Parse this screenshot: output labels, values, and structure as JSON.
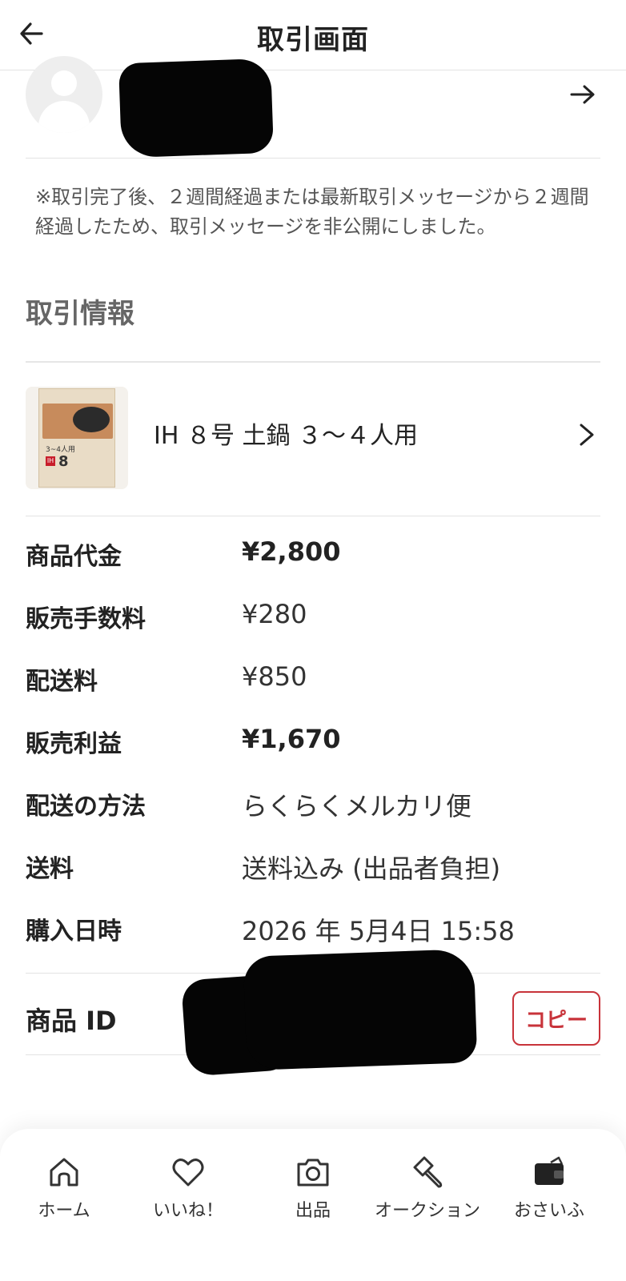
{
  "header": {
    "title": "取引画面"
  },
  "notice": "※取引完了後、２週間経過または最新取引メッセージから２週間経過したため、取引メッセージを非公開にしました。",
  "section_title": "取引情報",
  "product": {
    "name": "IH ８号 土鍋 ３～４人用",
    "box_label": "3~4人用",
    "box_ih": "IH",
    "box_num": "8"
  },
  "info": [
    {
      "label": "商品代金",
      "value": "¥2,800"
    },
    {
      "label": "販売手数料",
      "value": "¥280"
    },
    {
      "label": "配送料",
      "value": "¥850"
    },
    {
      "label": "販売利益",
      "value": "¥1,670"
    },
    {
      "label": "配送の方法",
      "value": "らくらくメルカリ便"
    },
    {
      "label": "送料",
      "value": "送料込み (出品者負担)"
    },
    {
      "label": "購入日時",
      "value": "2026 年 5月4日 15:58"
    }
  ],
  "product_id": {
    "label": "商品 ID",
    "copy_label": "コピー"
  },
  "nav": [
    {
      "label": "ホーム",
      "icon": "home-icon"
    },
    {
      "label": "いいね！",
      "icon": "heart-icon"
    },
    {
      "label": "出品",
      "icon": "camera-icon"
    },
    {
      "label": "オークション",
      "icon": "gavel-icon"
    },
    {
      "label": "おさいふ",
      "icon": "wallet-icon"
    }
  ],
  "colors": {
    "accent": "#c8333a",
    "text": "#222222",
    "muted": "#555555",
    "divider": "#e3e3e3"
  }
}
